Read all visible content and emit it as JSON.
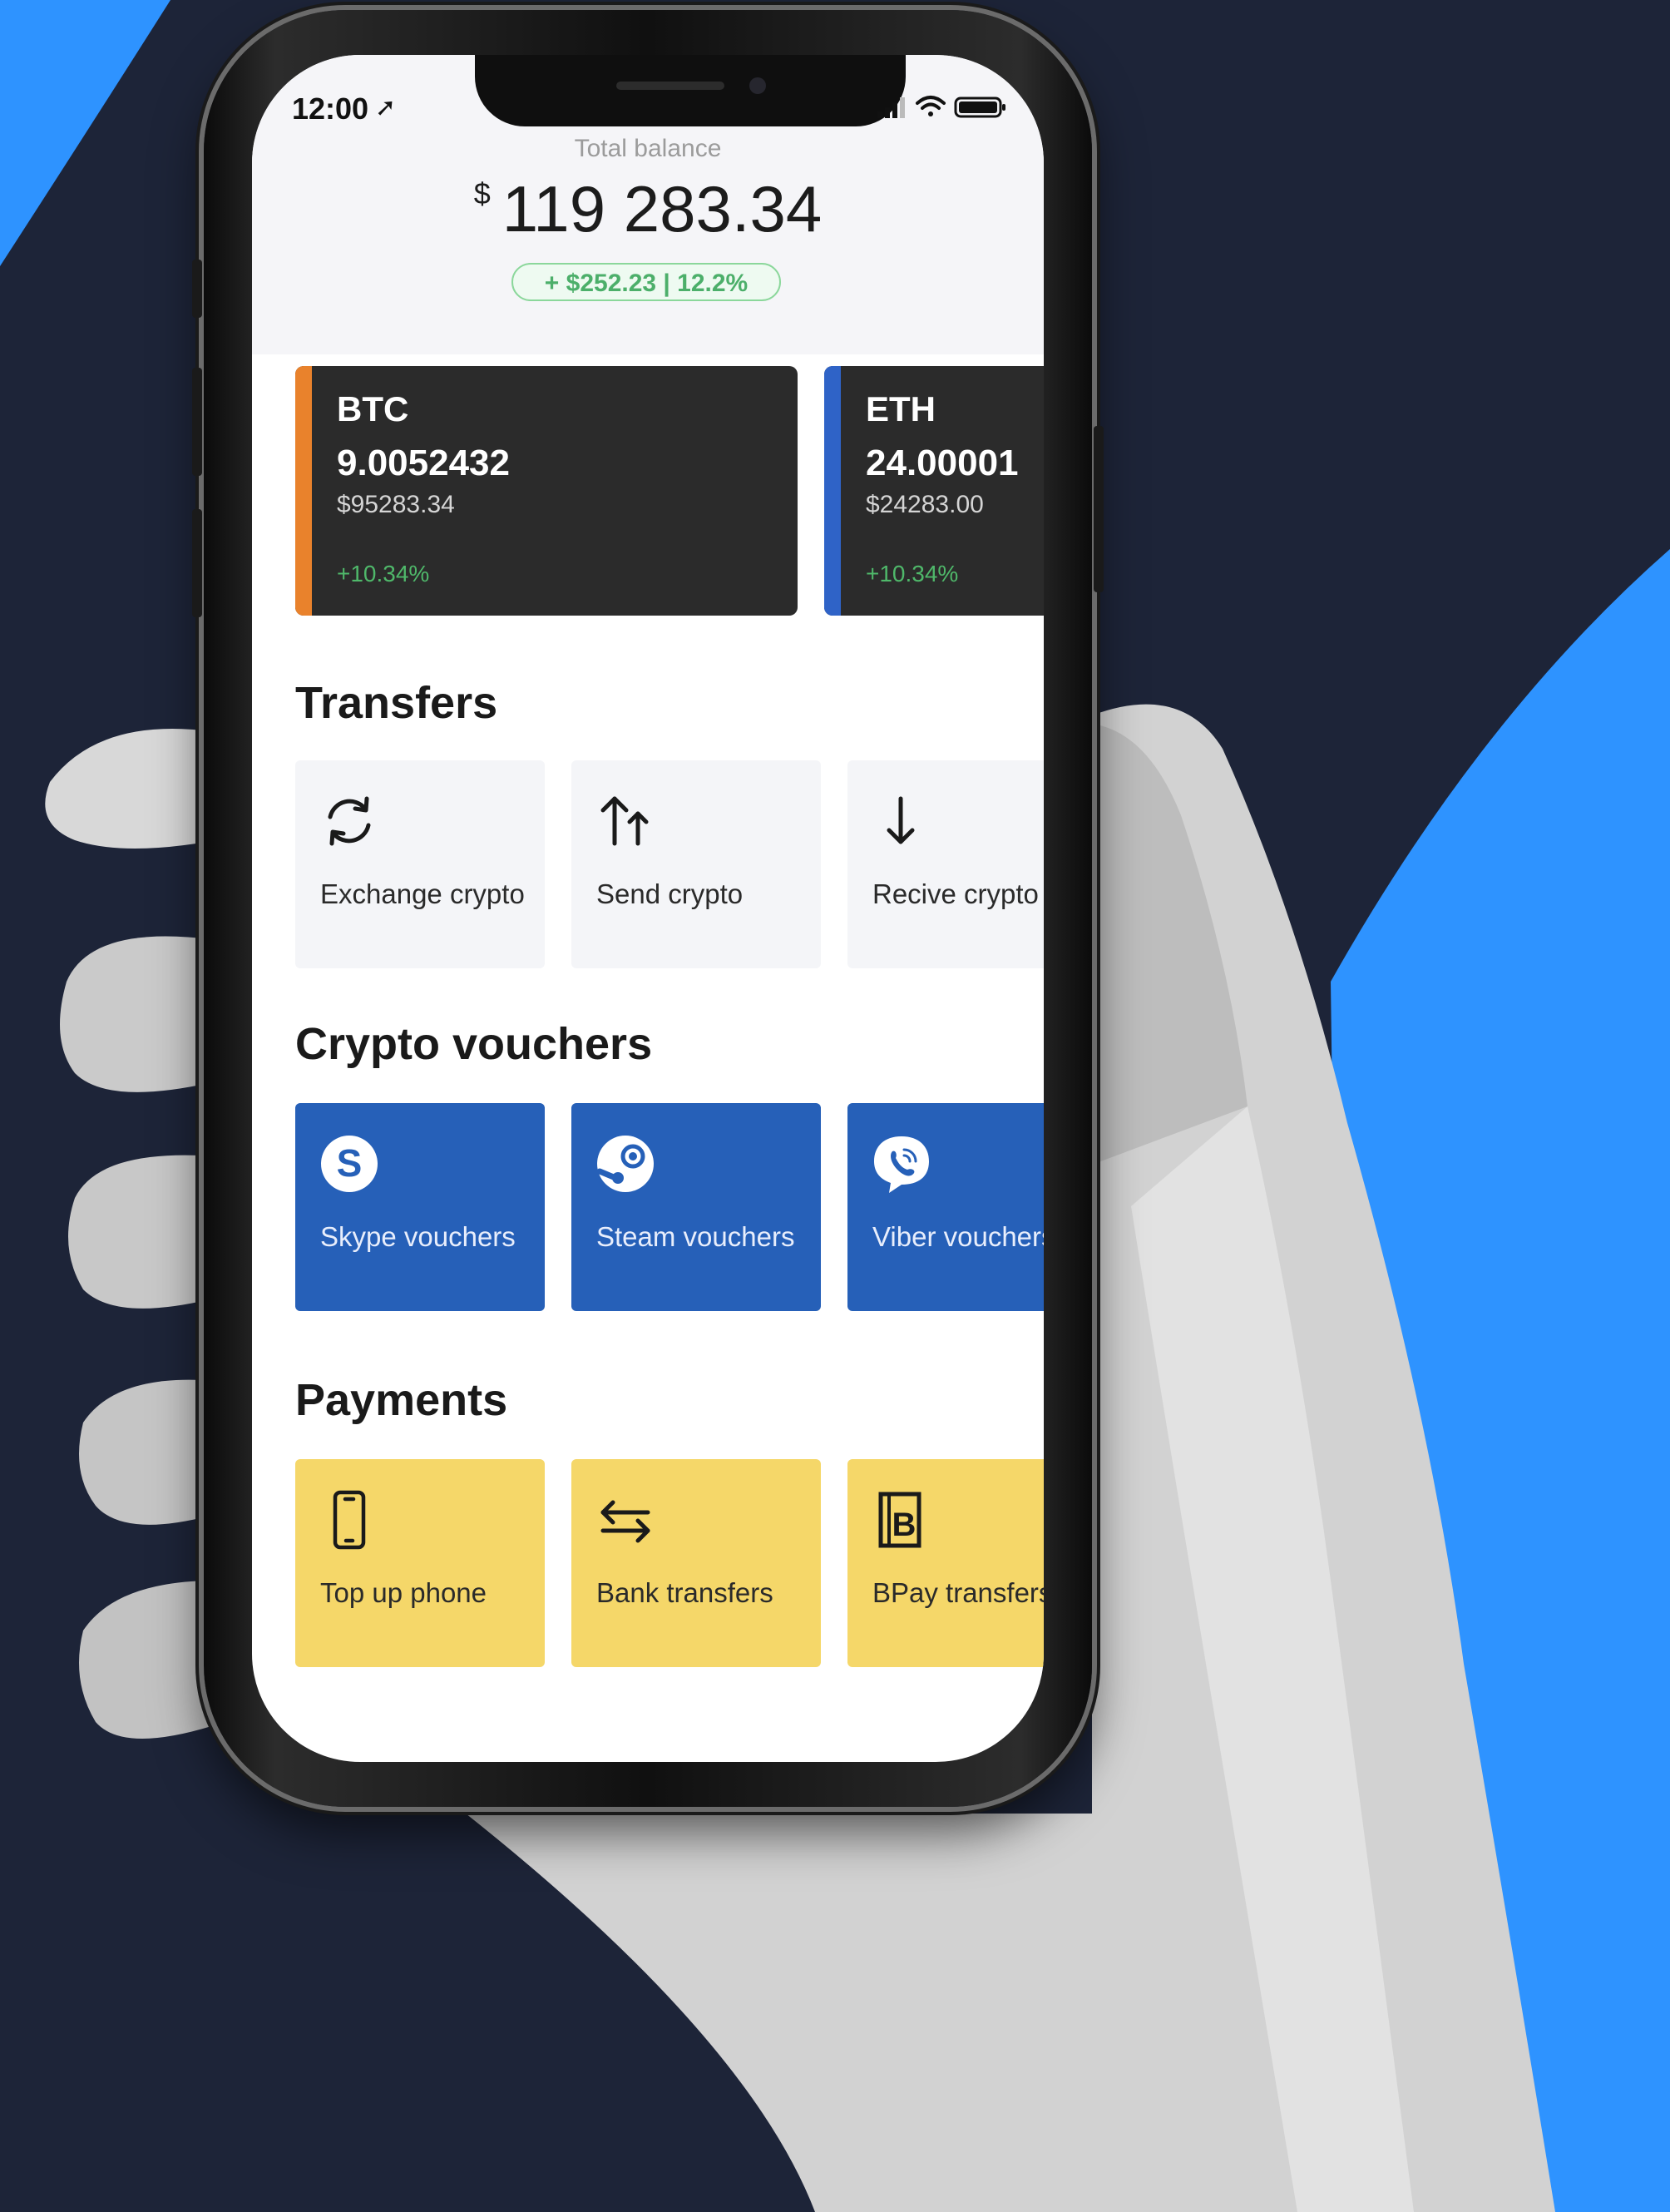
{
  "status_bar": {
    "time": "12:00",
    "location_glyph": "➚",
    "icons": [
      "signal-icon",
      "wifi-icon",
      "battery-icon"
    ]
  },
  "balance": {
    "label": "Total balance",
    "currency": "$",
    "amount": "119 283.34",
    "change": "+ $252.23  |  12.2%"
  },
  "coins": [
    {
      "symbol": "BTC",
      "amount": "9.0052432",
      "usd": "$95283.34",
      "change": "+10.34%",
      "accent": "#e9822c"
    },
    {
      "symbol": "ETH",
      "amount": "24.00001",
      "usd": "$24283.00",
      "change": "+10.34%",
      "accent": "#2f63c7"
    }
  ],
  "transfers": {
    "title": "Transfers",
    "items": [
      {
        "label": "Exchange crypto",
        "icon": "exchange-icon"
      },
      {
        "label": "Send crypto",
        "icon": "send-icon"
      },
      {
        "label": "Recive crypto",
        "icon": "receive-icon"
      }
    ]
  },
  "vouchers": {
    "title": "Crypto vouchers",
    "items": [
      {
        "label": "Skype vouchers",
        "icon": "skype-icon"
      },
      {
        "label": "Steam vouchers",
        "icon": "steam-icon"
      },
      {
        "label": "Viber vouchers",
        "icon": "viber-icon"
      }
    ]
  },
  "payments": {
    "title": "Payments",
    "items": [
      {
        "label": "Top up phone",
        "icon": "phone-icon"
      },
      {
        "label": "Bank transfers",
        "icon": "bank-transfer-icon"
      },
      {
        "label": "BPay transfers",
        "icon": "bpay-icon"
      }
    ]
  },
  "colors": {
    "background": "#1d2438",
    "accent_blue": "#2e93ff",
    "voucher_tile": "#2660b8",
    "payment_tile": "#f5d769",
    "positive": "#4fb86a"
  }
}
